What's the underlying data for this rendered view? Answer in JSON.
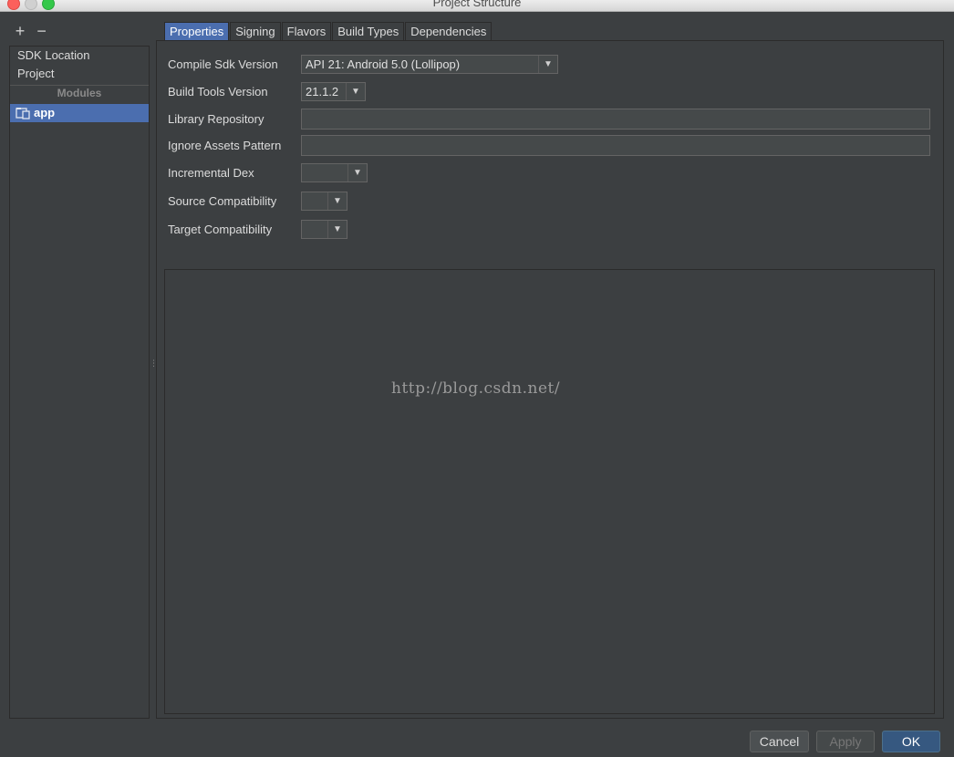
{
  "window": {
    "title": "Project Structure"
  },
  "toolbar": {
    "add_label": "+",
    "remove_label": "−"
  },
  "sidebar": {
    "items": [
      {
        "label": "SDK Location"
      },
      {
        "label": "Project"
      }
    ],
    "group_label": "Modules",
    "modules": [
      {
        "label": "app",
        "selected": true
      }
    ]
  },
  "tabs": [
    {
      "label": "Properties",
      "active": true
    },
    {
      "label": "Signing"
    },
    {
      "label": "Flavors"
    },
    {
      "label": "Build Types"
    },
    {
      "label": "Dependencies"
    }
  ],
  "properties": {
    "compile_sdk": {
      "label": "Compile Sdk Version",
      "value": "API 21: Android 5.0 (Lollipop)"
    },
    "build_tools": {
      "label": "Build Tools Version",
      "value": "21.1.2"
    },
    "library_repo": {
      "label": "Library Repository",
      "value": ""
    },
    "ignore_assets": {
      "label": "Ignore Assets Pattern",
      "value": ""
    },
    "incremental_dex": {
      "label": "Incremental Dex",
      "value": ""
    },
    "source_compat": {
      "label": "Source Compatibility",
      "value": ""
    },
    "target_compat": {
      "label": "Target Compatibility",
      "value": ""
    }
  },
  "watermark": "http://blog.csdn.net/",
  "buttons": {
    "cancel": "Cancel",
    "apply": "Apply",
    "ok": "OK"
  },
  "colors": {
    "accent": "#4b6eaf",
    "background": "#3c3f41",
    "primary_button": "#365880"
  }
}
